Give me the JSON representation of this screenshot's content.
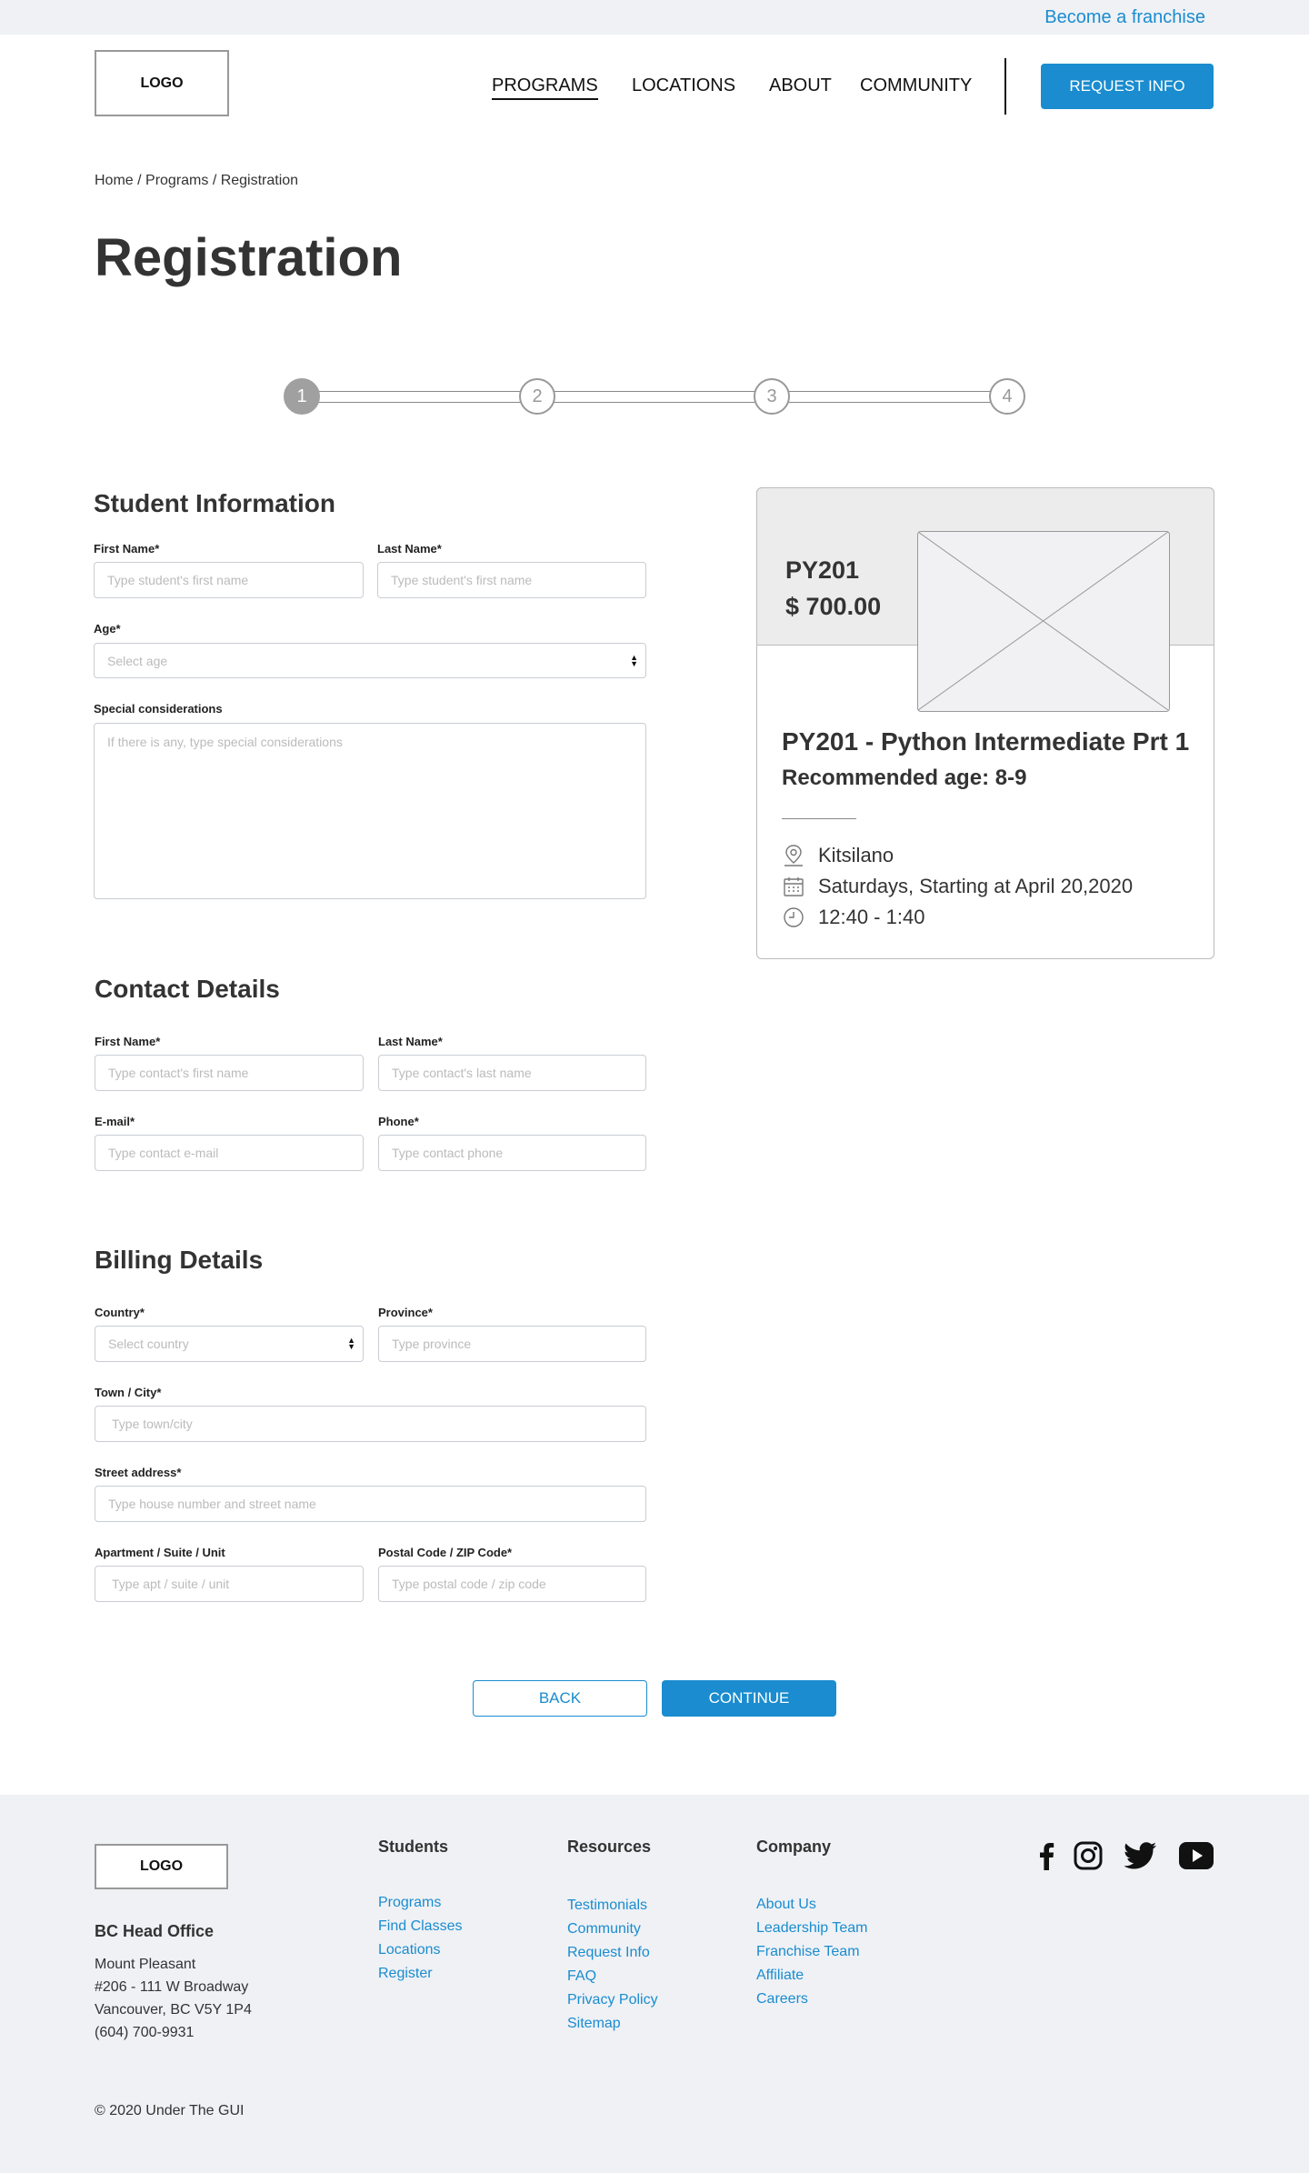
{
  "top_bar": {
    "franchise_link": "Become a franchise"
  },
  "header": {
    "logo": "LOGO",
    "nav": [
      "PROGRAMS",
      "LOCATIONS",
      "ABOUT",
      "COMMUNITY"
    ],
    "cta": "REQUEST INFO"
  },
  "breadcrumb": "Home / Programs / Registration",
  "page_title": "Registration",
  "stepper": {
    "steps": [
      "1",
      "2",
      "3",
      "4"
    ],
    "active_step": 1
  },
  "student": {
    "title": "Student Information",
    "first_name_label": "First Name*",
    "first_name_placeholder": "Type student's first name",
    "last_name_label": "Last Name*",
    "last_name_placeholder": "Type student's first name",
    "age_label": "Age*",
    "age_placeholder": "Select age",
    "special_label": "Special considerations",
    "special_placeholder": "If there is any, type special considerations"
  },
  "contact": {
    "title": "Contact Details",
    "first_name_label": "First Name*",
    "first_name_placeholder": "Type contact's first name",
    "last_name_label": "Last Name*",
    "last_name_placeholder": "Type contact's last name",
    "email_label": "E-mail*",
    "email_placeholder": "Type contact e-mail",
    "phone_label": "Phone*",
    "phone_placeholder": "Type contact phone"
  },
  "billing": {
    "title": "Billing Details",
    "country_label": "Country*",
    "country_placeholder": "Select country",
    "province_label": "Province*",
    "province_placeholder": "Type province",
    "city_label": "Town / City*",
    "city_placeholder": "Type town/city",
    "street_label": "Street address*",
    "street_placeholder": "Type house number and street name",
    "apt_label": "Apartment / Suite / Unit",
    "apt_placeholder": "Type apt / suite / unit",
    "postal_label": "Postal Code / ZIP Code*",
    "postal_placeholder": "Type postal code / zip code"
  },
  "actions": {
    "back": "BACK",
    "continue": "CONTINUE"
  },
  "course": {
    "code": "PY201",
    "price": "$ 700.00",
    "title": "PY201 - Python Intermediate Prt 1",
    "age": "Recommended age: 8-9",
    "location": "Kitsilano",
    "schedule": "Saturdays, Starting at April 20,2020",
    "time": "12:40 - 1:40"
  },
  "footer": {
    "logo": "LOGO",
    "office_title": "BC Head Office",
    "office_lines": [
      "Mount Pleasant",
      "#206 - 111 W Broadway",
      "Vancouver, BC V5Y 1P4",
      "(604) 700-9931"
    ],
    "students": {
      "heading": "Students",
      "links": [
        "Programs",
        "Find Classes",
        "Locations",
        "Register"
      ]
    },
    "resources": {
      "heading": "Resources",
      "links": [
        "Testimonials",
        "Community",
        "Request Info",
        "FAQ",
        "Privacy Policy",
        "Sitemap"
      ]
    },
    "company": {
      "heading": "Company",
      "links": [
        "About Us",
        "Leadership Team",
        "Franchise Team",
        "Affiliate",
        "Careers"
      ]
    },
    "social": [
      "facebook-icon",
      "instagram-icon",
      "twitter-icon",
      "youtube-icon"
    ],
    "copyright": "© 2020 Under The GUI"
  },
  "colors": {
    "accent": "#1a8ccf",
    "footer_bg": "#eff1f5",
    "text": "#333333"
  }
}
